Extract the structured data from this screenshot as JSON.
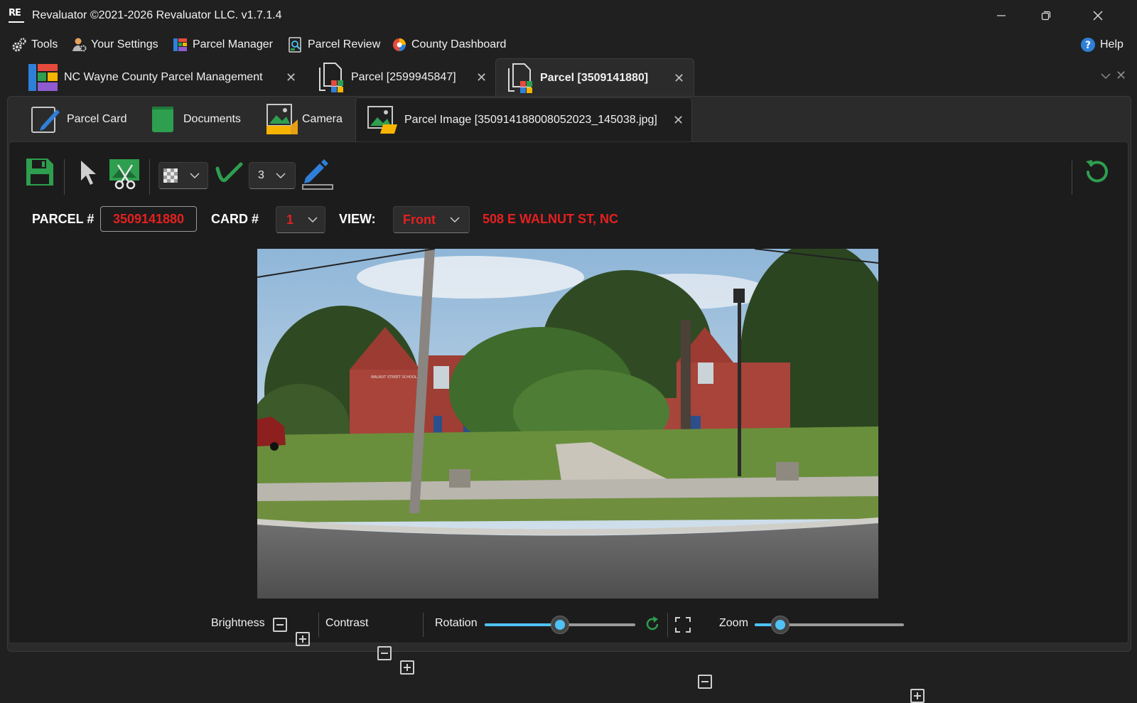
{
  "window": {
    "title": "Revaluator ©2021-2026 Revaluator LLC. v1.7.1.4",
    "logo_text": "RE"
  },
  "menu": {
    "tools": "Tools",
    "your_settings": "Your Settings",
    "parcel_manager": "Parcel Manager",
    "parcel_review": "Parcel Review",
    "county_dashboard": "County Dashboard",
    "help": "Help"
  },
  "doc_tabs": [
    {
      "label": "NC Wayne County Parcel Management"
    },
    {
      "label": "Parcel [2599945847]"
    },
    {
      "label": "Parcel [3509141880]"
    }
  ],
  "sub_tabs": [
    {
      "label": "Parcel Card"
    },
    {
      "label": "Documents"
    },
    {
      "label": "Camera"
    },
    {
      "label": "Parcel Image [350914188008052023_145038.jpg]"
    }
  ],
  "toolbar": {
    "stroke_width": "3"
  },
  "fields": {
    "parcel_label": "PARCEL #",
    "parcel_value": "3509141880",
    "card_label": "CARD #",
    "card_value": "1",
    "view_label": "VIEW:",
    "view_value": "Front",
    "address": "508 E WALNUT ST, NC"
  },
  "controls": {
    "brightness": "Brightness",
    "contrast": "Contrast",
    "rotation": "Rotation",
    "rotation_level": 0.5,
    "zoom": "Zoom",
    "zoom_level": 0.17
  },
  "photo": {
    "sign_text": "WALNUT STREET SCHOOL"
  },
  "colors": {
    "accent_green": "#2e9e4f",
    "value_red": "#e52020",
    "slider_blue": "#4fc3f7",
    "background": "#202020"
  }
}
